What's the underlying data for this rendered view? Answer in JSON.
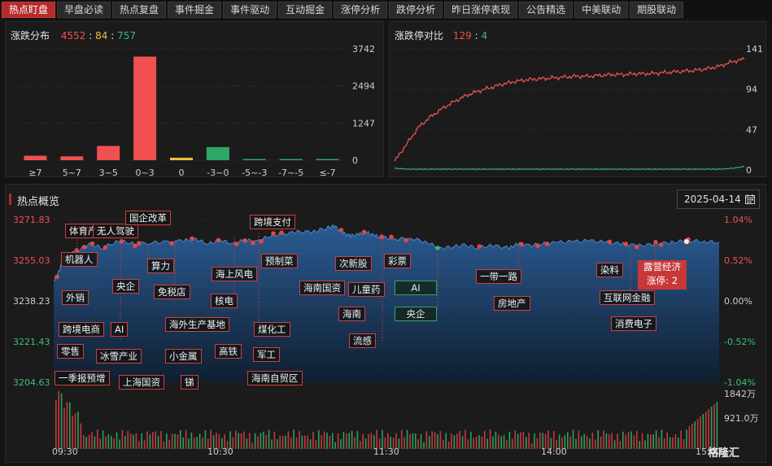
{
  "tabs": [
    {
      "label": "热点盯盘",
      "active": true
    },
    {
      "label": "早盘必读"
    },
    {
      "label": "热点复盘"
    },
    {
      "label": "事件掘金"
    },
    {
      "label": "事件驱动"
    },
    {
      "label": "互动掘金"
    },
    {
      "label": "涨停分析"
    },
    {
      "label": "跌停分析"
    },
    {
      "label": "昨日涨停表现"
    },
    {
      "label": "公告精选"
    },
    {
      "label": "中美联动"
    },
    {
      "label": "期股联动"
    }
  ],
  "distribution": {
    "title": "涨跌分布",
    "up": "4552",
    "sep1": ":",
    "flat": "84",
    "sep2": ":",
    "down": "757"
  },
  "limit": {
    "title": "涨跌停对比",
    "up": "129",
    "sep": ":",
    "down": "4"
  },
  "overview": {
    "title": "热点概览",
    "date": "2025-04-14",
    "left_axis": [
      "3271.83",
      "3255.03",
      "3238.23",
      "3221.43",
      "3204.63"
    ],
    "right_axis": [
      "1.04%",
      "0.52%",
      "0.00%",
      "-0.52%",
      "-1.04%"
    ],
    "volume_axis": [
      "1842万",
      "921.0万"
    ],
    "time_axis": [
      "09:30",
      "10:30",
      "11:30",
      "14:00",
      "15:00"
    ],
    "tooltip": {
      "name": "露营经济",
      "line": "涨停: 2"
    },
    "tags": [
      {
        "label": "体育产业"
      },
      {
        "label": "无人驾驶"
      },
      {
        "label": "国企改革"
      },
      {
        "label": "跨境支付"
      },
      {
        "label": "机器人"
      },
      {
        "label": "算力"
      },
      {
        "label": "海上风电"
      },
      {
        "label": "预制菜"
      },
      {
        "label": "次新股"
      },
      {
        "label": "彩票"
      },
      {
        "label": "央企"
      },
      {
        "label": "免税店"
      },
      {
        "label": "海南国资"
      },
      {
        "label": "儿童药"
      },
      {
        "label": "AI"
      },
      {
        "label": "外销"
      },
      {
        "label": "核电"
      },
      {
        "label": "一带一路"
      },
      {
        "label": "染料"
      },
      {
        "label": "房地产"
      },
      {
        "label": "互联网金融"
      },
      {
        "label": "跨境电商"
      },
      {
        "label": "AI"
      },
      {
        "label": "海外生产基地"
      },
      {
        "label": "煤化工"
      },
      {
        "label": "海南"
      },
      {
        "label": "央企"
      },
      {
        "label": "消费电子"
      },
      {
        "label": "零售"
      },
      {
        "label": "冰雪产业"
      },
      {
        "label": "小金属"
      },
      {
        "label": "高铁"
      },
      {
        "label": "军工"
      },
      {
        "label": "流感"
      },
      {
        "label": "一季报预增"
      },
      {
        "label": "上海国资"
      },
      {
        "label": "锑"
      },
      {
        "label": "海南自贸区"
      }
    ]
  },
  "watermark": "格隆汇",
  "colors": {
    "up": "#f05050",
    "down": "#2ea866",
    "flat": "#e8c040",
    "accent": "#b52a2a"
  },
  "chart_data": [
    {
      "type": "bar",
      "title": "涨跌分布",
      "categories": [
        "≥7",
        "5~7",
        "3~5",
        "0~3",
        "0",
        "-3~0",
        "-5~-3",
        "-7~-5",
        "≤-7"
      ],
      "values": [
        150,
        130,
        480,
        3480,
        84,
        440,
        25,
        8,
        4
      ],
      "yticks": [
        3742,
        2494,
        1247,
        0
      ],
      "ylim": [
        0,
        3742
      ]
    },
    {
      "type": "line",
      "title": "涨跌停对比",
      "yticks": [
        141,
        94,
        47,
        0
      ],
      "ylim": [
        0,
        141
      ],
      "series": [
        {
          "values": [
            10,
            30,
            50,
            62,
            72,
            80,
            87,
            92,
            96,
            100,
            103,
            105,
            106,
            107,
            108,
            109,
            109,
            110,
            111,
            111,
            112,
            112,
            113,
            114,
            115,
            116,
            118,
            121,
            126,
            129
          ]
        },
        {
          "values": [
            2,
            1,
            1,
            1,
            1,
            1,
            1,
            1,
            1,
            1,
            1,
            1,
            1,
            1,
            1,
            1,
            1,
            1,
            1,
            1,
            1,
            1,
            1,
            1,
            1,
            1,
            1,
            1,
            2,
            4
          ]
        }
      ]
    }
  ]
}
